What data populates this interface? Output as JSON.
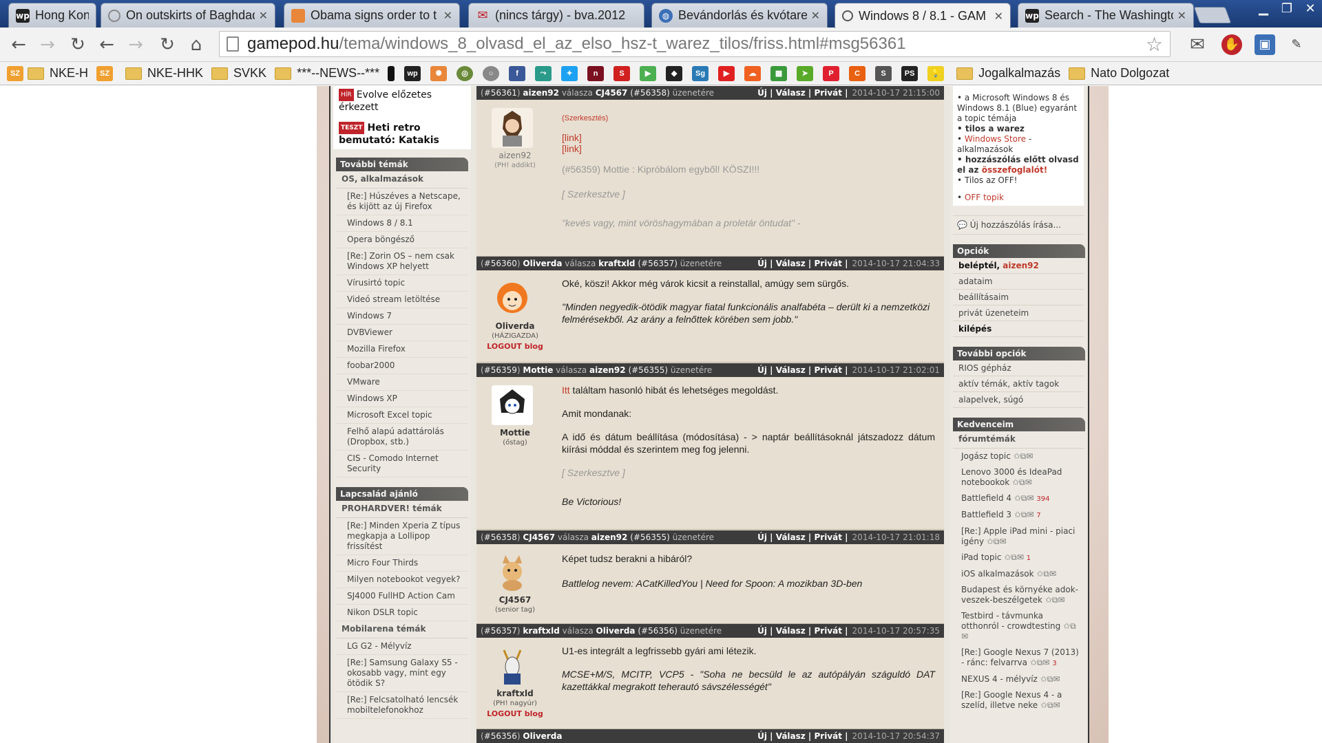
{
  "tabs": [
    {
      "label": "Hong Kong",
      "favicon": "wp"
    },
    {
      "label": "On outskirts of Baghdad",
      "favicon": "loading"
    },
    {
      "label": "Obama signs order to t",
      "favicon": "orange"
    },
    {
      "label": "(nincs tárgy) - bva.2012",
      "favicon": "gmail"
    },
    {
      "label": "Bevándorlás és kvótarendszer",
      "favicon": "globe"
    },
    {
      "label": "Windows 8 / 8.1 - GAM",
      "favicon": "gamepod"
    },
    {
      "label": "Search - The Washingto",
      "favicon": "wp"
    }
  ],
  "omnibox": {
    "host": "gamepod.hu",
    "path": "/tema/windows_8_olvasd_el_az_elso_hsz-t_warez_tilos/friss.html#msg56361"
  },
  "bookmarks": [
    {
      "label": "NKE-H",
      "type": "sz"
    },
    {
      "label": "",
      "type": "sz"
    },
    {
      "label": "NKE-HHK",
      "type": "folder"
    },
    {
      "label": "SVKK",
      "type": "folder"
    },
    {
      "label": "***--NEWS--***",
      "type": "folder"
    },
    {
      "label": "Jogalkalmazás",
      "type": "folder"
    },
    {
      "label": "Nato Dolgozat",
      "type": "folder"
    }
  ],
  "left": {
    "news": [
      {
        "tag": "HÍR",
        "text": "Evolve előzetes érkezett"
      },
      {
        "tag": "TESZT",
        "text": "Heti retro bemutató: Katakis"
      }
    ],
    "further_topics_title": "További témák",
    "os_subhead": "OS, alkalmazások",
    "os_items": [
      "[Re:] Húszéves a Netscape, és kijött az új Firefox",
      "Windows 8 / 8.1",
      "Opera böngésző",
      "[Re:] Zorin OS – nem csak Windows XP helyett",
      "Vírusirtó topic",
      "Videó stream letöltése",
      "Windows 7",
      "DVBViewer",
      "Mozilla Firefox",
      "foobar2000",
      "VMware",
      "Windows XP",
      "Microsoft Excel topic",
      "Felhő alapú adattárolás (Dropbox, stb.)",
      "CIS - Comodo Internet Security"
    ],
    "family_title": "Lapcsalád ajánló",
    "prohardver_subhead": "PROHARDVER! témák",
    "prohardver_items": [
      "[Re:] Minden Xperia Z típus megkapja a Lollipop frissítést",
      "Micro Four Thirds",
      "Milyen notebookot vegyek?",
      "SJ4000 FullHD Action Cam",
      "Nikon DSLR topic"
    ],
    "mobil_subhead": "Mobilarena témák",
    "mobil_items": [
      "LG G2 - Mélyvíz",
      "[Re:] Samsung Galaxy S5 - okosabb vagy, mint egy ötödik S?",
      "[Re:] Felcsatolható lencsék mobiltelefonokhoz"
    ]
  },
  "posts": [
    {
      "id": "#56361",
      "author": "aizen92",
      "replyword": "válasza",
      "to": "CJ4567",
      "to_id": "#56358",
      "suffix": "üzenetére",
      "actions": "Új | Válasz | Privát |",
      "date": "2014-10-17 21:15:00",
      "rank": "(PH! addikt)",
      "blog": "",
      "lines": [
        "(Szerkesztés)",
        "[link]",
        "[link]",
        "(#56359) Mottie : Kipróbálom egyből! KÖSZI!!!",
        "[ Szerkesztve ]",
        "\"kevés vagy, mint vöröshagymában a proletár öntudat\" -"
      ]
    },
    {
      "id": "#56360",
      "author": "Oliverda",
      "replyword": "válasza",
      "to": "kraftxld",
      "to_id": "#56357",
      "suffix": "üzenetére",
      "actions": "Új | Válasz | Privát |",
      "date": "2014-10-17 21:04:33",
      "rank": "(HÁZIGAZDA)",
      "blog": "LOGOUT blog",
      "lines": [
        "Oké, köszi! Akkor még várok kicsit a reinstallal, amúgy sem sürgős.",
        "\"Minden negyedik-ötödik magyar fiatal funkcionális analfabéta – derült ki a nemzetközi felmérésekből. Az arány a felnőttek körében sem jobb.\""
      ]
    },
    {
      "id": "#56359",
      "author": "Mottie",
      "replyword": "válasza",
      "to": "aizen92",
      "to_id": "#56355",
      "suffix": "üzenetére",
      "actions": "Új | Válasz | Privát |",
      "date": "2014-10-17 21:02:01",
      "rank": "(őstag)",
      "blog": "",
      "lines": [
        "Itt",
        " találtam hasonló hibát és lehetséges megoldást.",
        "Amit mondanak:",
        "A idő és dátum beállítása (módosítása) - > naptár beállításoknál játszadozz dátum kiírási móddal és szerintem meg fog jelenni.",
        "[ Szerkesztve ]",
        "Be Victorious!"
      ]
    },
    {
      "id": "#56358",
      "author": "CJ4567",
      "replyword": "válasza",
      "to": "aizen92",
      "to_id": "#56355",
      "suffix": "üzenetére",
      "actions": "Új | Válasz | Privát |",
      "date": "2014-10-17 21:01:18",
      "rank": "(senior tag)",
      "blog": "",
      "lines": [
        "Képet tudsz berakni a hibáról?",
        "Battlelog nevem: ACatKilledYou | Need for Spoon: A mozikban 3D-ben"
      ]
    },
    {
      "id": "#56357",
      "author": "kraftxld",
      "replyword": "válasza",
      "to": "Oliverda",
      "to_id": "#56356",
      "suffix": "üzenetére",
      "actions": "Új | Válasz | Privát |",
      "date": "2014-10-17 20:57:35",
      "rank": "(PH! nagyúr)",
      "blog": "LOGOUT blog",
      "lines": [
        "U1-es integrált a legfrissebb gyári ami létezik.",
        "MCSE+M/S, MCITP, VCP5 - \"Soha ne becsüld le az autópályán száguldó DAT kazettákkal megrakott teherautó sávszélességét\""
      ]
    },
    {
      "id": "#56356",
      "author": "Oliverda",
      "actions": "Új | Válasz | Privát |",
      "date": "2014-10-17 20:54:37"
    }
  ],
  "right": {
    "rules": [
      "a Microsoft Windows 8 és Windows 8.1 (Blue) egyaránt a topic témája",
      "tilos a warez",
      "Windows Store",
      " - alkalmazások",
      "hozzászólás előtt olvasd el az ",
      "összefoglalót!",
      "Tilos az OFF!",
      "OFF topik"
    ],
    "new_post": "Új hozzászólás írása...",
    "options_title": "Opciók",
    "logged_in": "beléptél, ",
    "username": "aizen92",
    "options": [
      "adataim",
      "beállításaim",
      "privát üzeneteim",
      "kilépés"
    ],
    "more_options_title": "További opciók",
    "more_options": [
      "RIOS gépház",
      "aktív témák, aktív tagok",
      "alapelvek, súgó"
    ],
    "favorites_title": "Kedvenceim",
    "favorites_subhead": "fórumtémák",
    "favorites": [
      {
        "label": "Jogász topic",
        "count": ""
      },
      {
        "label": "Lenovo 3000 és IdeaPad notebookok",
        "count": ""
      },
      {
        "label": "Battlefield 4",
        "count": "394"
      },
      {
        "label": "Battlefield 3",
        "count": "7"
      },
      {
        "label": "[Re:] Apple iPad mini - piaci igény",
        "count": ""
      },
      {
        "label": "iPad topic",
        "count": "1"
      },
      {
        "label": "iOS alkalmazások",
        "count": ""
      },
      {
        "label": "Budapest és környéke adok-veszek-beszélgetek",
        "count": ""
      },
      {
        "label": "Testbird - távmunka otthonról - crowdtesting",
        "count": ""
      },
      {
        "label": "[Re:] Google Nexus 7 (2013) - ránc: felvarrva",
        "count": "3"
      },
      {
        "label": "NEXUS 4 - mélyvíz",
        "count": ""
      },
      {
        "label": "[Re:] Google Nexus 4 - a szelíd, illetve neke",
        "count": ""
      }
    ]
  },
  "colors": {
    "accent_red": "#c0242b",
    "header_dark": "#3c3c3c",
    "post_bg": "#e7dfd1"
  }
}
